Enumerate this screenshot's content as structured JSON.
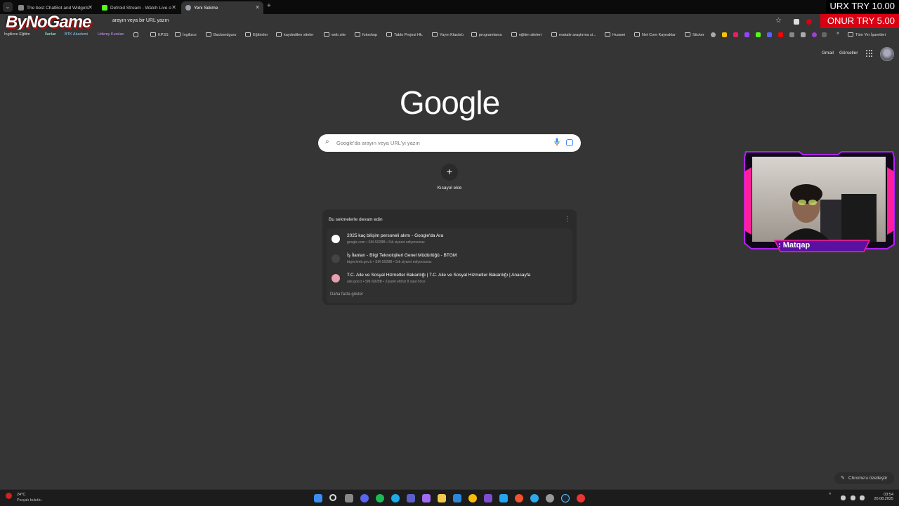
{
  "tabs": [
    {
      "title": "The best ChatBot and Widgets",
      "color": "#888888"
    },
    {
      "title": "Defroid Stream - Watch Live o",
      "color": "#53fc18"
    },
    {
      "title": "Yeni Sekme",
      "color": "#9aa0a6",
      "active": true
    }
  ],
  "toolbar": {
    "address_placeholder": "arayın veya bir URL yazın"
  },
  "stream_overlay": {
    "logo": "ByNoGame",
    "urx_label": "URX  TRY 10.00",
    "onur_label": "ONUR  TRY 5.00",
    "webcam_name": ": Matqap"
  },
  "bookmarks": {
    "items": [
      "İngilizce Eğitim",
      "İlanları",
      "BTK Akademi",
      "Udemy Kursları",
      "KPSS",
      "İngilizce",
      "Backendguru",
      "Eğitimler",
      "kaydedilen siteler",
      "web site",
      "fotoshop",
      "Tablo Projesi Hk.",
      "Yayın Klasörü",
      "programlama",
      "eğitim siteleri",
      "makale araştırma si...",
      "Huawei",
      "Net Core Kaynaklar",
      "Sticker"
    ],
    "overflow": "»",
    "all_bookmarks": "Tüm Yer İşaretleri"
  },
  "newtab": {
    "gmail": "Gmail",
    "images": "Görseller",
    "logo": "Google",
    "search_placeholder": "Google'da arayın veya URL'yi yazın",
    "shortcut_label": "Kısayol ekle",
    "continue_title": "Bu sekmelerle devam edin",
    "rows": [
      {
        "title": "2025 kaç bilişim personeli alımı - Google'da Ara",
        "sub": "google.com • SM-S928B • Sık ziyaret ediyorsunuz",
        "icon_color": "#ffffff"
      },
      {
        "title": "İş İlanları - Bilgi Teknolojileri Genel Müdürlüğü - BTGM",
        "sub": "btgm.hmb.gov.tr • SM-S928B • Sık ziyaret ediyorsunuz",
        "icon_color": "#444444"
      },
      {
        "title": "T.C. Aile ve Sosyal Hizmetler Bakanlığı | T.C. Aile ve Sosyal Hizmetler Bakanlığı | Anasayfa",
        "sub": "aile.gov.tr • SM-S928B • Ziyaret ettiniz 8 saat önce",
        "icon_color": "#e8a0b0"
      }
    ],
    "show_more": "Daha fazla göster",
    "customize": "Chrome'u özelleştir"
  },
  "taskbar": {
    "temp": "24°C",
    "weather": "Parçalı bulutlu",
    "time": "03:54",
    "date": "20.08.2025"
  }
}
